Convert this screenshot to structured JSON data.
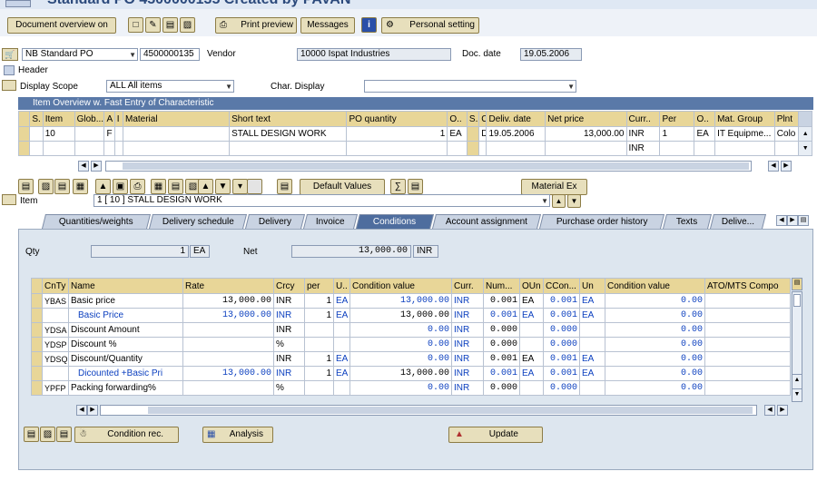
{
  "window": {
    "title": "Standard PO 4500000135 Created by PAVAN"
  },
  "toolbar": {
    "doc_overview": "Document overview on",
    "print_preview": "Print preview",
    "messages": "Messages",
    "personal_setting": "Personal setting",
    "icons": [
      "new-doc-icon",
      "edit-icon",
      "display-icon",
      "other-po-icon"
    ]
  },
  "header": {
    "doc_type": "NB Standard PO",
    "po_number": "4500000135",
    "vendor_label": "Vendor",
    "vendor_value": "10000 Ispat Industries",
    "doc_date_label": "Doc. date",
    "doc_date_value": "19.05.2006",
    "header_label": "Header",
    "display_scope_label": "Display Scope",
    "display_scope_value": "ALL All items",
    "char_display_label": "Char. Display",
    "char_display_value": ""
  },
  "item_overview": {
    "title": "Item Overview w. Fast Entry of Characteristic",
    "columns": [
      "S.",
      "Item",
      "Glob...",
      "A",
      "I",
      "Material",
      "Short text",
      "PO quantity",
      "O..",
      "S.",
      "C",
      "Deliv. date",
      "Net price",
      "Curr..",
      "Per",
      "O..",
      "Mat. Group",
      "Plnt"
    ],
    "row1": {
      "item": "10",
      "a": "F",
      "short_text": "STALL DESIGN WORK",
      "qty": "1",
      "uom": "EA",
      "c": "D",
      "deliv_date": "19.05.2006",
      "net_price": "13,000.00",
      "curr": "INR",
      "per": "1",
      "o": "EA",
      "mat_group": "IT Equipme...",
      "plant": "Colo"
    },
    "row2": {
      "curr": "INR"
    }
  },
  "item_toolbar": {
    "default_values": "Default Values",
    "material_ex": "Material Ex",
    "item_label": "Item",
    "item_value": "1 [ 10 ] STALL DESIGN WORK"
  },
  "tabs": [
    "Quantities/weights",
    "Delivery schedule",
    "Delivery",
    "Invoice",
    "Conditions",
    "Account assignment",
    "Purchase order history",
    "Texts",
    "Delive..."
  ],
  "active_tab": "Conditions",
  "conditions": {
    "qty_label": "Qty",
    "qty_value": "1",
    "qty_unit": "EA",
    "net_label": "Net",
    "net_value": "13,000.00",
    "net_curr": "INR",
    "columns": [
      "CnTy",
      "Name",
      "Rate",
      "Crcy",
      "per",
      "U..",
      "Condition value",
      "Curr.",
      "Num...",
      "OUn",
      "CCon...",
      "Un",
      "Condition value",
      "ATO/MTS Compo"
    ],
    "rows": [
      {
        "cnty": "YBAS",
        "name": "Basic price",
        "rate": "13,000.00",
        "crcy": "INR",
        "per": "1",
        "u": "EA",
        "cond": "13,000.00",
        "curr": "INR",
        "num": "0.001",
        "oun": "EA",
        "ccon": "0.001",
        "un": "EA",
        "cond2": "0.00"
      },
      {
        "cnty": "",
        "name": "Basic Price",
        "rate": "13,000.00",
        "crcy": "INR",
        "per": "1",
        "u": "EA",
        "cond": "13,000.00",
        "curr": "INR",
        "num": "0.001",
        "oun": "EA",
        "ccon": "0.001",
        "un": "EA",
        "cond2": "0.00"
      },
      {
        "cnty": "YDSA",
        "name": "Discount Amount",
        "rate": "",
        "crcy": "INR",
        "per": "",
        "u": "",
        "cond": "0.00",
        "curr": "INR",
        "num": "0.000",
        "oun": "",
        "ccon": "0.000",
        "un": "",
        "cond2": "0.00"
      },
      {
        "cnty": "YDSP",
        "name": "Discount %",
        "rate": "",
        "crcy": "%",
        "per": "",
        "u": "",
        "cond": "0.00",
        "curr": "INR",
        "num": "0.000",
        "oun": "",
        "ccon": "0.000",
        "un": "",
        "cond2": "0.00"
      },
      {
        "cnty": "YDSQ",
        "name": "Discount/Quantity",
        "rate": "",
        "crcy": "INR",
        "per": "1",
        "u": "EA",
        "cond": "0.00",
        "curr": "INR",
        "num": "0.001",
        "oun": "EA",
        "ccon": "0.001",
        "un": "EA",
        "cond2": "0.00"
      },
      {
        "cnty": "",
        "name": "Dicounted +Basic Pri",
        "rate": "13,000.00",
        "crcy": "INR",
        "per": "1",
        "u": "EA",
        "cond": "13,000.00",
        "curr": "INR",
        "num": "0.001",
        "oun": "EA",
        "ccon": "0.001",
        "un": "EA",
        "cond2": "0.00"
      },
      {
        "cnty": "YPFP",
        "name": "Packing forwarding%",
        "rate": "",
        "crcy": "%",
        "per": "",
        "u": "",
        "cond": "0.00",
        "curr": "INR",
        "num": "0.000",
        "oun": "",
        "ccon": "0.000",
        "un": "",
        "cond2": "0.00"
      }
    ],
    "condition_rec": "Condition rec.",
    "analysis": "Analysis",
    "update": "Update"
  }
}
